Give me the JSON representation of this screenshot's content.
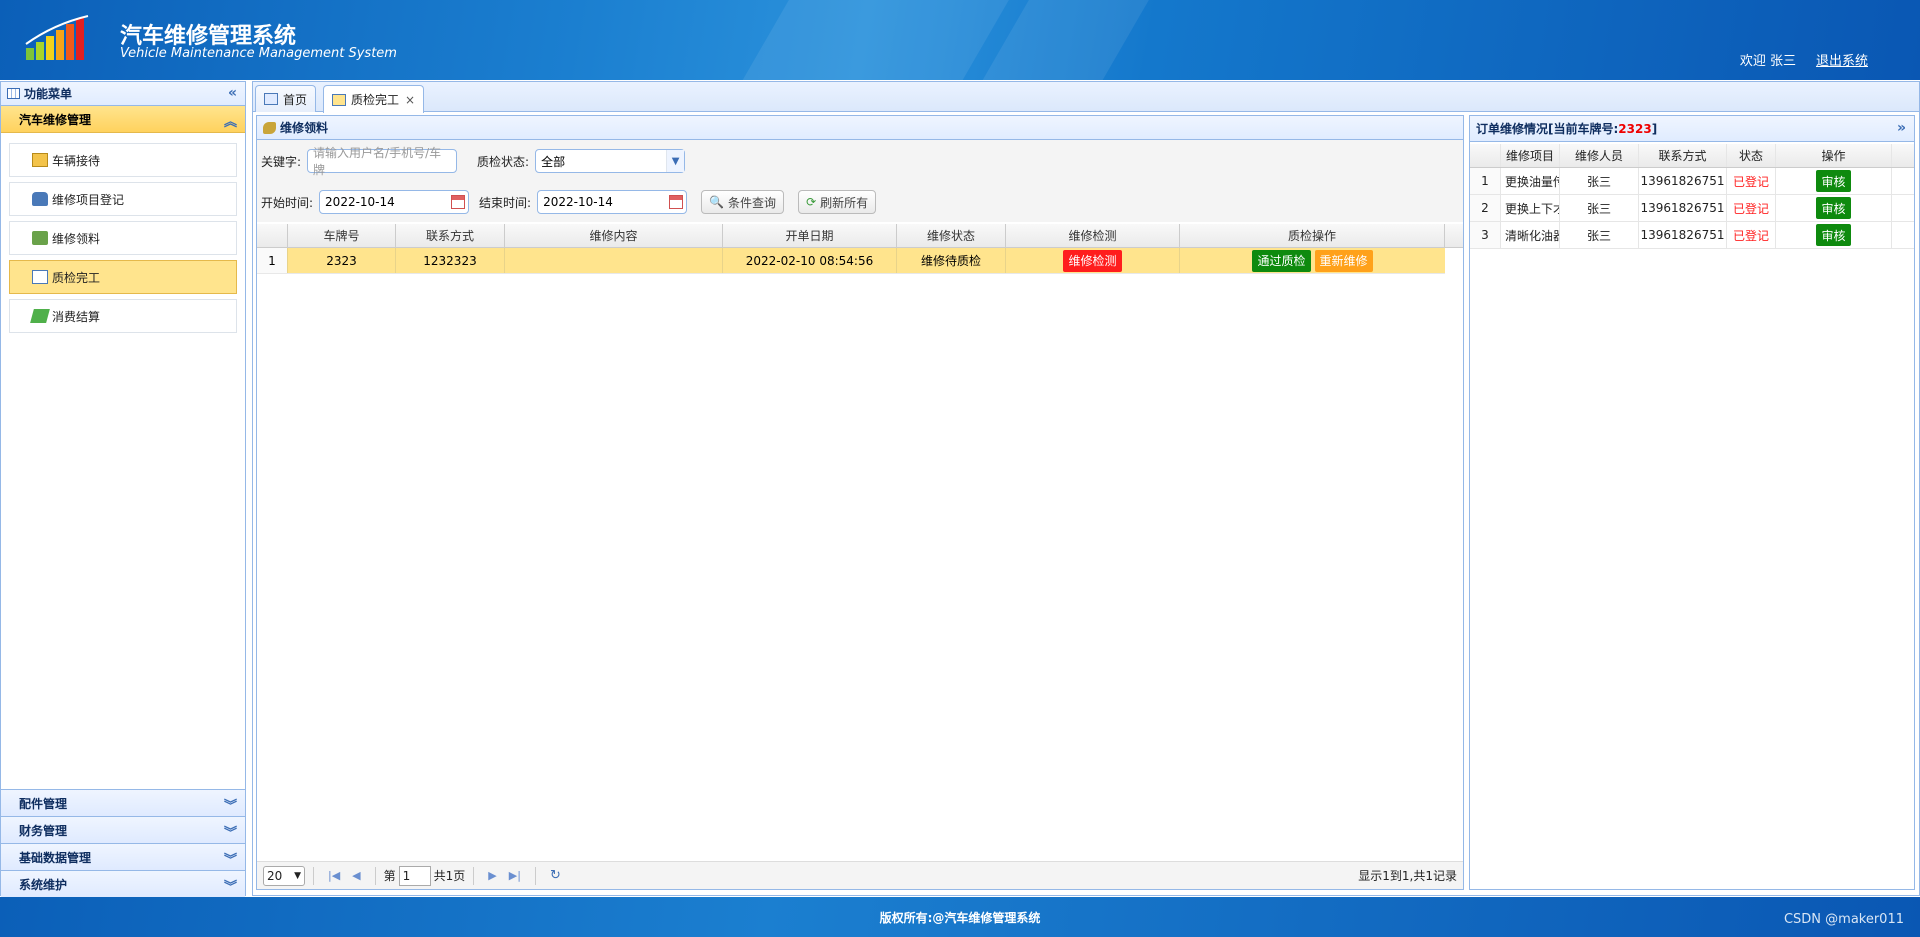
{
  "header": {
    "title": "汽车维修管理系统",
    "subtitle": "Vehicle Maintenance Management System",
    "welcome": "欢迎 张三",
    "logout": "退出系统"
  },
  "sidebar": {
    "title": "功能菜单",
    "expanded_group": "汽车维修管理",
    "items": [
      {
        "label": "车辆接待"
      },
      {
        "label": "维修项目登记"
      },
      {
        "label": "维修领料"
      },
      {
        "label": "质检完工"
      },
      {
        "label": "消费结算"
      }
    ],
    "collapsed_groups": [
      {
        "label": "配件管理"
      },
      {
        "label": "财务管理"
      },
      {
        "label": "基础数据管理"
      },
      {
        "label": "系统维护"
      }
    ]
  },
  "tabs": [
    {
      "label": "首页"
    },
    {
      "label": "质检完工"
    }
  ],
  "main": {
    "panel_title": "维修领料",
    "keyword_label": "关键字:",
    "keyword_placeholder": "请输入用户名/手机号/车牌",
    "qc_status_label": "质检状态:",
    "qc_status_value": "全部",
    "start_label": "开始时间:",
    "start_value": "2022-10-14",
    "end_label": "结束时间:",
    "end_value": "2022-10-14",
    "search_button": "条件查询",
    "refresh_button": "刷新所有",
    "columns": [
      "车牌号",
      "联系方式",
      "维修内容",
      "开单日期",
      "维修状态",
      "维修检测",
      "质检操作"
    ],
    "rows": [
      {
        "num": "1",
        "plate": "2323",
        "contact": "1232323",
        "content": "",
        "date": "2022-02-10 08:54:56",
        "status": "维修待质检",
        "check_btn": "维修检测",
        "pass_btn": "通过质检",
        "redo_btn": "重新维修"
      }
    ],
    "pager": {
      "page_size": "20",
      "page_prefix": "第",
      "page_value": "1",
      "page_total": "共1页",
      "info": "显示1到1,共1记录"
    }
  },
  "right": {
    "title_prefix": "订单维修情况[当前车牌号:",
    "plate": "2323",
    "title_suffix": "]",
    "columns": [
      "维修项目",
      "维修人员",
      "联系方式",
      "状态",
      "操作"
    ],
    "rows": [
      {
        "num": "1",
        "item": "更换油量传",
        "staff": "张三",
        "phone": "13961826751",
        "status": "已登记",
        "op": "审核"
      },
      {
        "num": "2",
        "item": "更换上下才",
        "staff": "张三",
        "phone": "13961826751",
        "status": "已登记",
        "op": "审核"
      },
      {
        "num": "3",
        "item": "清晰化油器",
        "staff": "张三",
        "phone": "13961826751",
        "status": "已登记",
        "op": "审核"
      }
    ]
  },
  "footer": {
    "copyright": "版权所有:@汽车维修管理系统",
    "watermark": "CSDN @maker011"
  },
  "colors": {
    "header_blue": "#1478cc",
    "selected_yellow": "#ffe48d",
    "border_blue": "#95b8e7",
    "danger_red": "#ff1d1d",
    "success_green": "#0e8a0e",
    "warning_orange": "#ffa11a"
  }
}
